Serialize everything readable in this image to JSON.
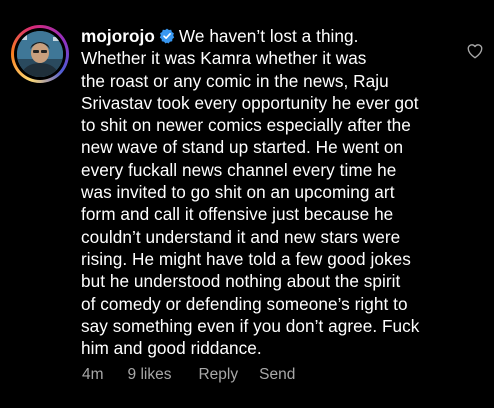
{
  "comment": {
    "username": "mojorojo",
    "verified": true,
    "text_lines": [
      "We haven’t lost a thing.",
      "Whether it was Kamra whether it was",
      "the roast or any comic in the news, Raju",
      "Srivastav took every opportunity he ever got",
      "to shit on newer comics especially after the",
      "new wave of stand up started. He went on",
      "every fuckall news channel every time he",
      "was invited to go shit on an upcoming art",
      "form and call it offensive just because he",
      "couldn’t understand it and new stars were",
      "rising. He might have told a few good jokes",
      "but he understood nothing about the spirit",
      "of comedy or defending someone’s right to",
      "say something even if you don’t agree. Fuck",
      "him and good riddance."
    ],
    "time": "4m",
    "likes": "9 likes",
    "reply_label": "Reply",
    "send_label": "Send"
  },
  "icons": {
    "verified": "verified-badge-icon",
    "like": "heart-outline-icon"
  },
  "colors": {
    "background": "#000000",
    "text": "#ffffff",
    "meta": "#a8a8a8",
    "verified": "#3897f0"
  }
}
